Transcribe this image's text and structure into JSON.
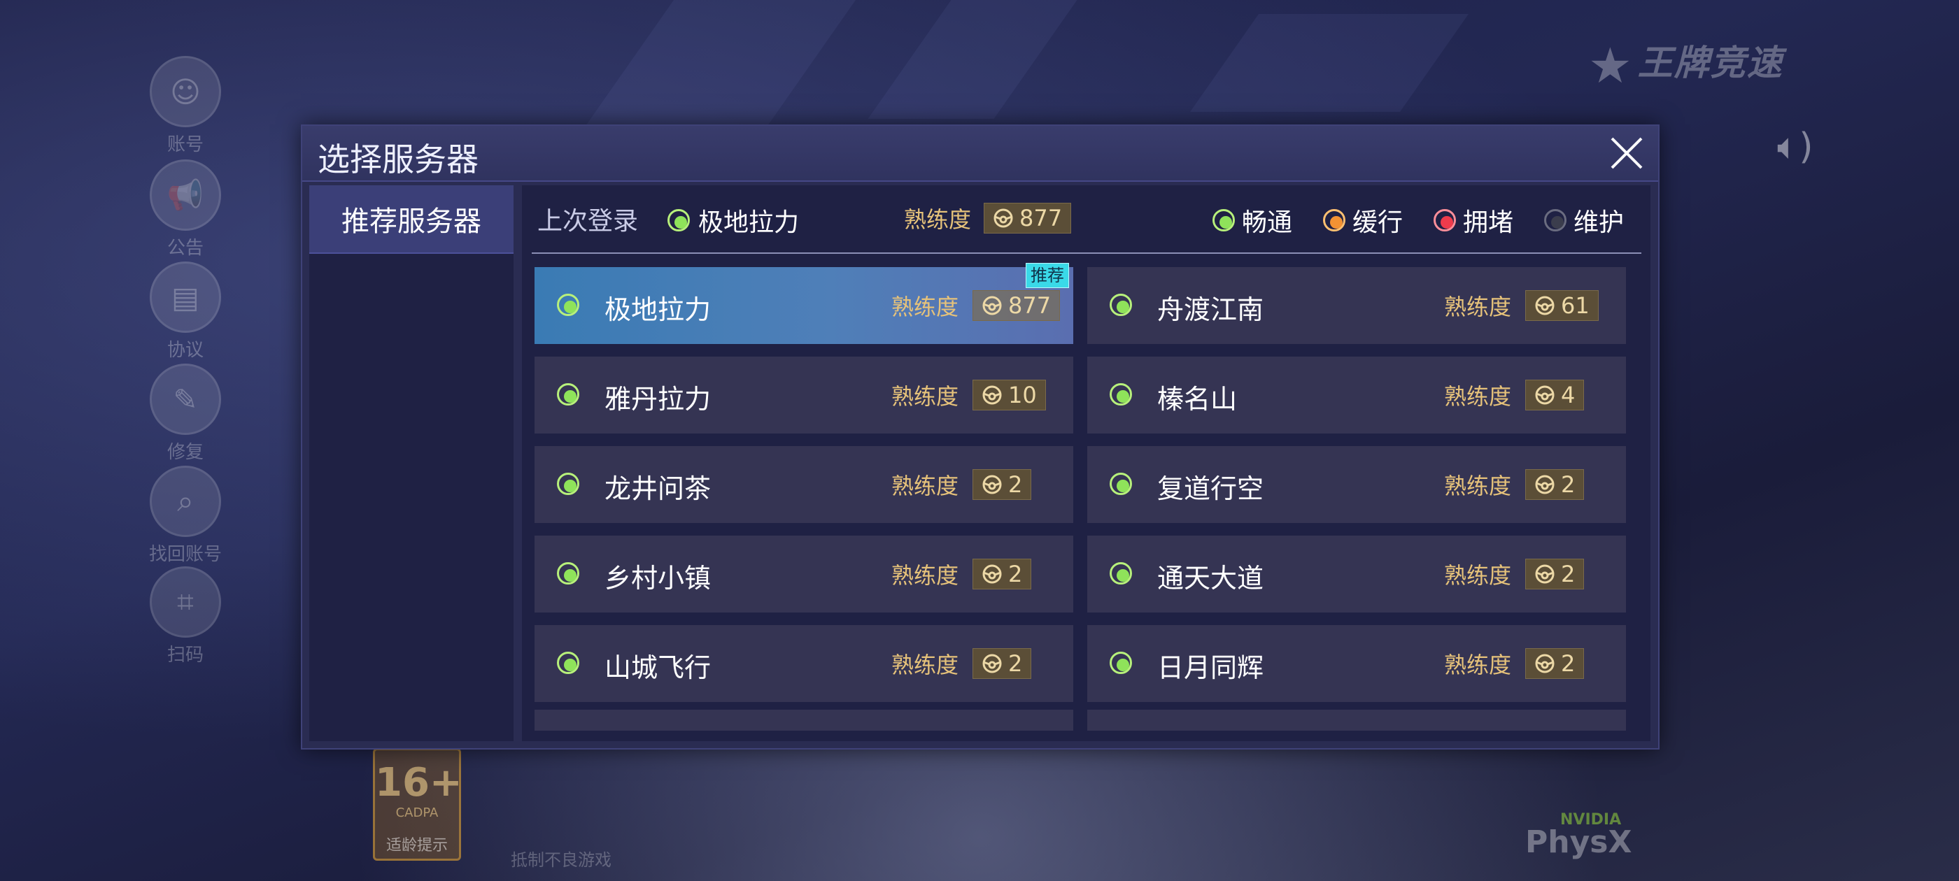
{
  "dialog": {
    "title": "选择服务器",
    "sidebar_tab": "推荐服务器",
    "last_login_label": "上次登录",
    "last_login_server": "极地拉力",
    "proficiency_label": "熟练度",
    "last_login_proficiency": "877",
    "legend": [
      {
        "label": "畅通",
        "status": "green"
      },
      {
        "label": "缓行",
        "status": "orange"
      },
      {
        "label": "拥堵",
        "status": "red"
      },
      {
        "label": "维护",
        "status": "gray"
      }
    ],
    "recommend_tag": "推荐",
    "servers": [
      {
        "name": "极地拉力",
        "proficiency": "877",
        "status": "green",
        "selected": true
      },
      {
        "name": "舟渡江南",
        "proficiency": "61",
        "status": "green"
      },
      {
        "name": "雅丹拉力",
        "proficiency": "10",
        "status": "green"
      },
      {
        "name": "榛名山",
        "proficiency": "4",
        "status": "green"
      },
      {
        "name": "龙井问茶",
        "proficiency": "2",
        "status": "green"
      },
      {
        "name": "复道行空",
        "proficiency": "2",
        "status": "green"
      },
      {
        "name": "乡村小镇",
        "proficiency": "2",
        "status": "green"
      },
      {
        "name": "通天大道",
        "proficiency": "2",
        "status": "green"
      },
      {
        "name": "山城飞行",
        "proficiency": "2",
        "status": "green"
      },
      {
        "name": "日月同辉",
        "proficiency": "2",
        "status": "green"
      }
    ]
  },
  "background": {
    "logo": "王牌竞速",
    "left_menu": [
      "账号",
      "公告",
      "协议",
      "修复",
      "找回账号",
      "扫码"
    ],
    "age_rating": "16+",
    "age_rating_org": "CADPA",
    "age_tip": "适龄提示",
    "physx_vendor": "NVIDIA",
    "physx": "PhysX",
    "footnote": "抵制不良游戏"
  },
  "colors": {
    "dialog_bg": "#2a2c52",
    "selected_row": "#3a7bb4",
    "status_green": "#8fe35a",
    "status_orange": "#f39233",
    "status_red": "#ef3b4c",
    "status_gray": "#3b3d4d",
    "proficiency_gold": "#e6c27a"
  },
  "icons": {
    "close": "close-icon",
    "wheel": "steering-wheel-icon",
    "sound": "speaker-icon"
  }
}
